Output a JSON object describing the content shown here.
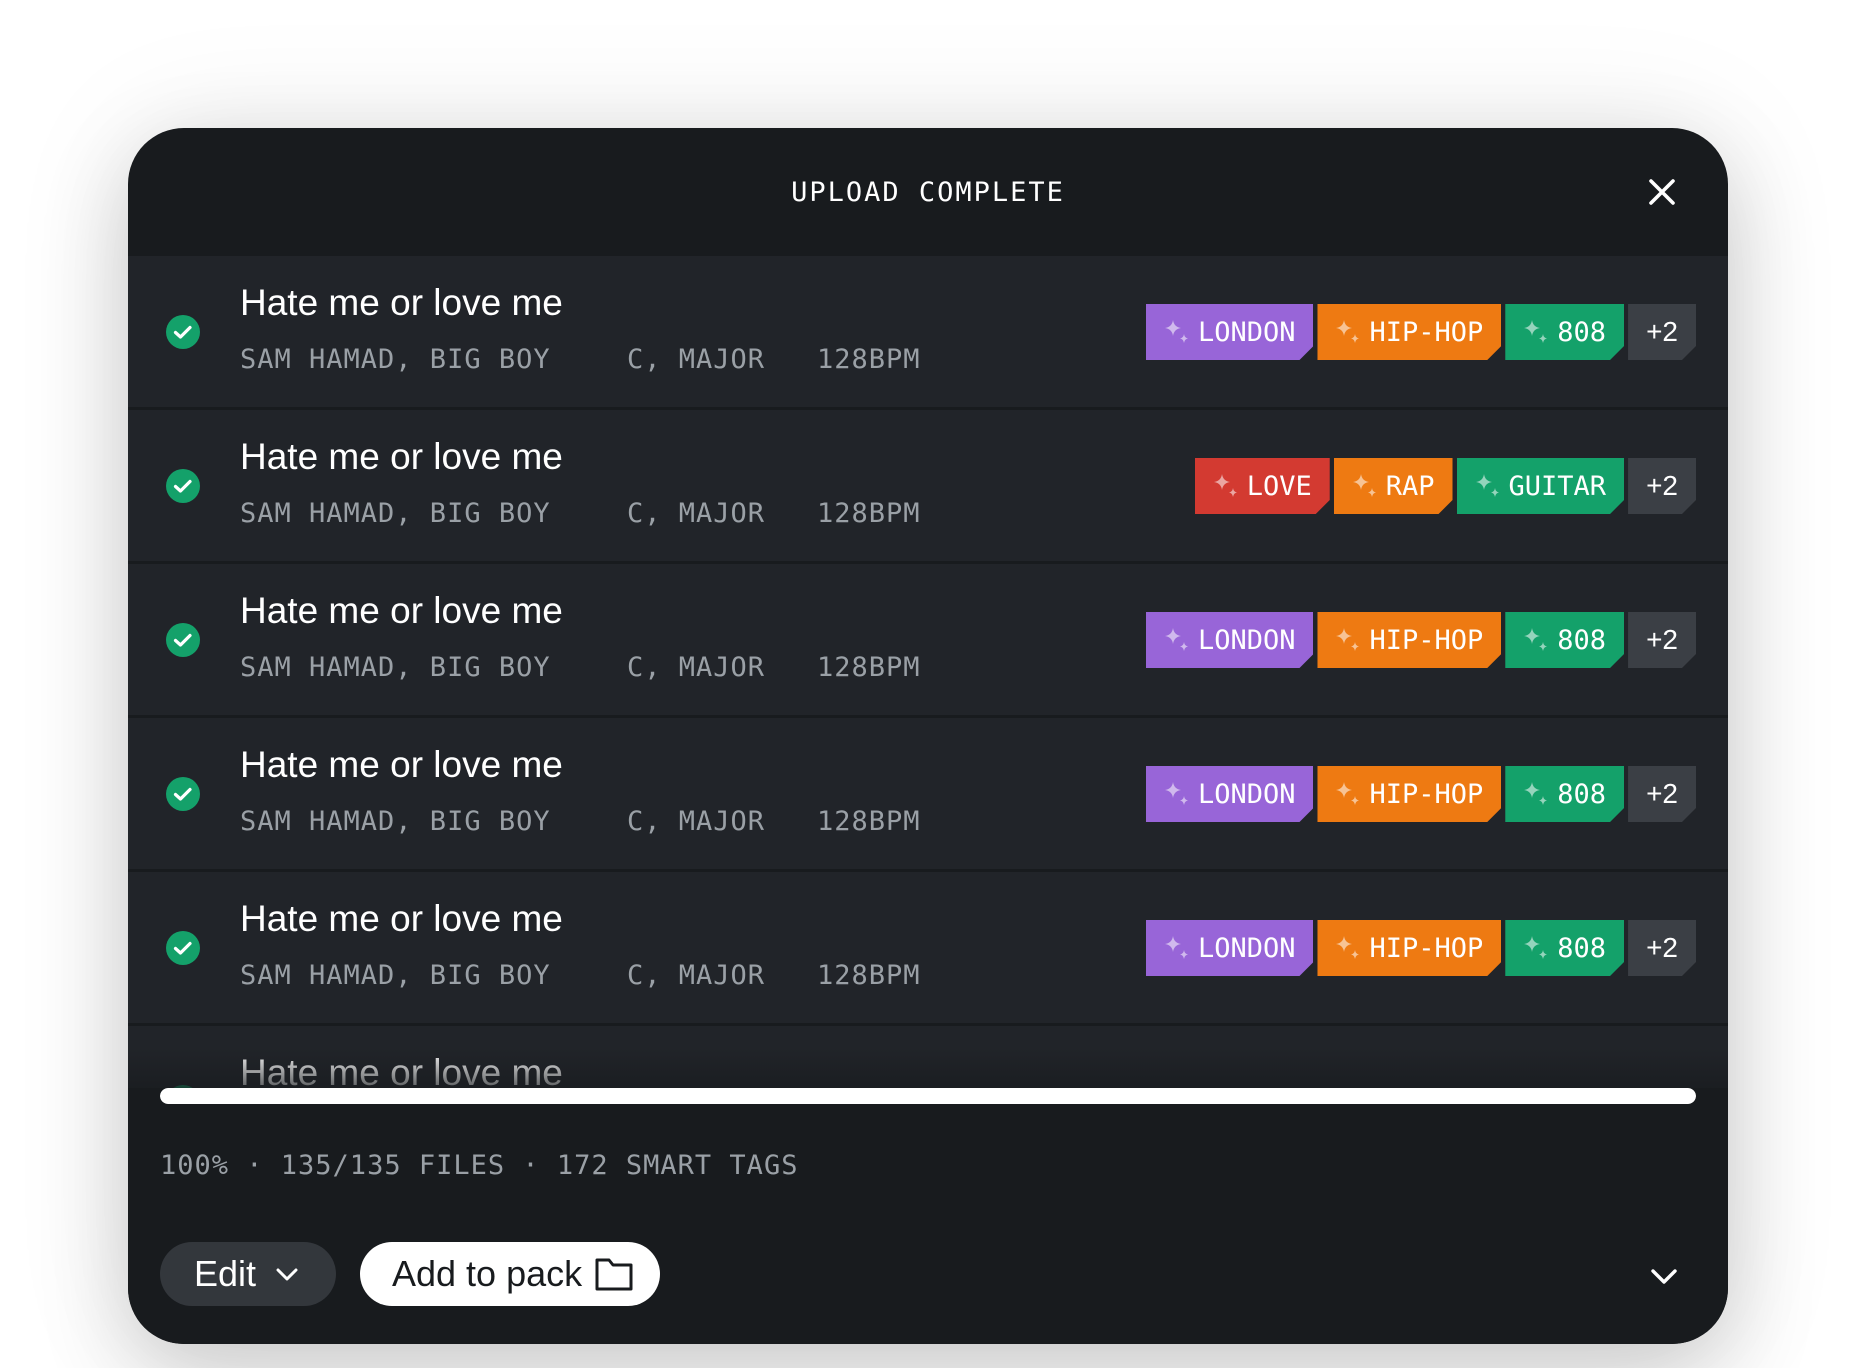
{
  "header": {
    "title": "UPLOAD COMPLETE"
  },
  "rows": [
    {
      "title": "Hate me or love me",
      "artist": "SAM HAMAD, BIG BOY",
      "key": "C, MAJOR",
      "bpm": "128BPM",
      "tags": [
        {
          "label": "LONDON",
          "color": "purple"
        },
        {
          "label": "HIP-HOP",
          "color": "orange"
        },
        {
          "label": "808",
          "color": "green"
        }
      ],
      "more": "+2"
    },
    {
      "title": "Hate me or love me",
      "artist": "SAM HAMAD, BIG BOY",
      "key": "C, MAJOR",
      "bpm": "128BPM",
      "tags": [
        {
          "label": "LOVE",
          "color": "red"
        },
        {
          "label": "RAP",
          "color": "orange"
        },
        {
          "label": "GUITAR",
          "color": "green"
        }
      ],
      "more": "+2"
    },
    {
      "title": "Hate me or love me",
      "artist": "SAM HAMAD, BIG BOY",
      "key": "C, MAJOR",
      "bpm": "128BPM",
      "tags": [
        {
          "label": "LONDON",
          "color": "purple"
        },
        {
          "label": "HIP-HOP",
          "color": "orange"
        },
        {
          "label": "808",
          "color": "green"
        }
      ],
      "more": "+2"
    },
    {
      "title": "Hate me or love me",
      "artist": "SAM HAMAD, BIG BOY",
      "key": "C, MAJOR",
      "bpm": "128BPM",
      "tags": [
        {
          "label": "LONDON",
          "color": "purple"
        },
        {
          "label": "HIP-HOP",
          "color": "orange"
        },
        {
          "label": "808",
          "color": "green"
        }
      ],
      "more": "+2"
    },
    {
      "title": "Hate me or love me",
      "artist": "SAM HAMAD, BIG BOY",
      "key": "C, MAJOR",
      "bpm": "128BPM",
      "tags": [
        {
          "label": "LONDON",
          "color": "purple"
        },
        {
          "label": "HIP-HOP",
          "color": "orange"
        },
        {
          "label": "808",
          "color": "green"
        }
      ],
      "more": "+2"
    },
    {
      "title": "Hate me or love me",
      "artist": "",
      "key": "",
      "bpm": "",
      "tags": [],
      "more": ""
    }
  ],
  "footer": {
    "progress": 1.0,
    "stats": "100% · 135/135 FILES · 172 SMART TAGS",
    "edit_label": "Edit",
    "add_to_pack_label": "Add to pack"
  },
  "colors": {
    "purple": "#9865d8",
    "orange": "#ee7a12",
    "green": "#14a16a",
    "red": "#d33a31",
    "check": "#14a16a",
    "panel_bg": "#181b1e",
    "row_bg": "#212429"
  },
  "icons": {
    "close": "close-icon",
    "check": "check-circle-icon",
    "spark": "sparkle-icon",
    "chevron": "chevron-down-icon",
    "folder": "folder-icon"
  }
}
